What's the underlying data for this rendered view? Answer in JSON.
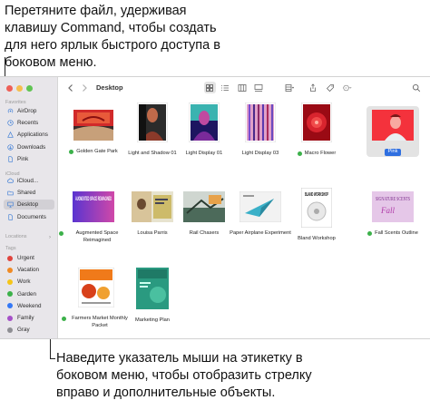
{
  "callouts": {
    "top": "Перетяните файл, удерживая клавишу Command, чтобы создать для него ярлык быстрого доступа в боковом меню.",
    "bottom": "Наведите указатель мыши на этикетку в боковом меню, чтобы отобразить стрелку вправо и дополнительные объекты."
  },
  "window": {
    "title": "Desktop"
  },
  "sidebar": {
    "favorites_title": "Favorites",
    "favorites": [
      {
        "label": "AirDrop",
        "icon": "airdrop-icon"
      },
      {
        "label": "Recents",
        "icon": "clock-icon"
      },
      {
        "label": "Applications",
        "icon": "applications-icon"
      },
      {
        "label": "Downloads",
        "icon": "download-icon"
      },
      {
        "label": "Pink",
        "icon": "document-icon"
      }
    ],
    "icloud_title": "iCloud",
    "icloud": [
      {
        "label": "iCloud...",
        "icon": "cloud-icon"
      },
      {
        "label": "Shared",
        "icon": "shared-folder-icon"
      },
      {
        "label": "Desktop",
        "icon": "desktop-icon",
        "selected": true
      },
      {
        "label": "Documents",
        "icon": "document-icon"
      }
    ],
    "locations_title": "Locations",
    "tags_title": "Tags",
    "tags": [
      {
        "label": "Urgent",
        "color": "#e0443e"
      },
      {
        "label": "Vacation",
        "color": "#f08a24"
      },
      {
        "label": "Work",
        "color": "#f5c518"
      },
      {
        "label": "Garden",
        "color": "#3cb14a"
      },
      {
        "label": "Weekend",
        "color": "#3478f6"
      },
      {
        "label": "Family",
        "color": "#a550c8"
      },
      {
        "label": "Gray",
        "color": "#8e8e93"
      }
    ]
  },
  "files": [
    {
      "name": "Golden Gate Park",
      "tag": "#3cb14a"
    },
    {
      "name": "Light and Shadow 01",
      "tag": null
    },
    {
      "name": "Light Display 01",
      "tag": null
    },
    {
      "name": "Light Display 03",
      "tag": null
    },
    {
      "name": "Macro Flower",
      "tag": "#3cb14a"
    },
    {
      "name": "Pink",
      "tag": null,
      "selected": true
    },
    {
      "name": "Augmented Space Reimagined",
      "tag": "#3cb14a"
    },
    {
      "name": "Louisa Parris",
      "tag": null
    },
    {
      "name": "Rail Chasers",
      "tag": null
    },
    {
      "name": "Paper Airplane Experiment",
      "tag": null
    },
    {
      "name": "Bland Workshop",
      "tag": null
    },
    {
      "name": "Fall Scents Outline",
      "tag": "#3cb14a"
    },
    {
      "name": "Farmers Market Monthly Packet",
      "tag": "#3cb14a"
    },
    {
      "name": "Marketing Plan",
      "tag": null
    }
  ],
  "thumb_text": {
    "augmented": "AUGMENTED SPACE REIMAGINED",
    "bland": "BLAND WORKSHOP",
    "signature": "SIGNATURE SCENTS",
    "signature_script": "Fall"
  }
}
